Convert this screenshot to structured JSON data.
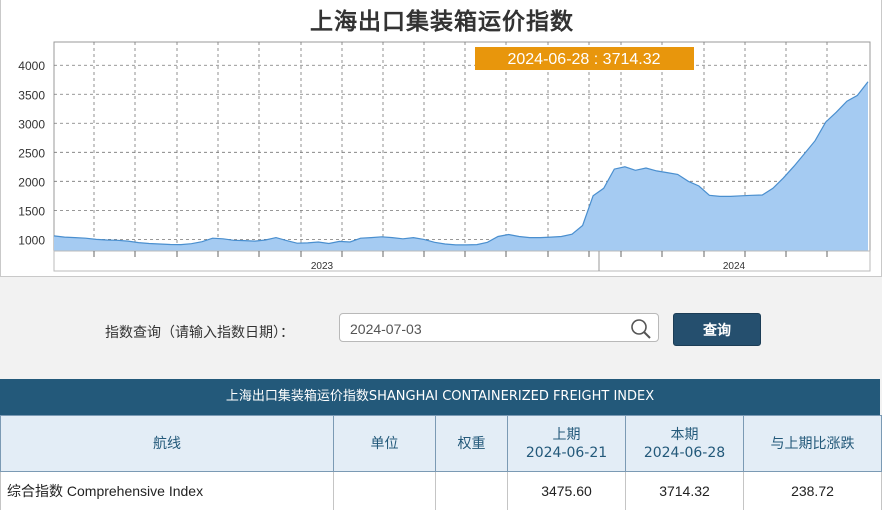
{
  "page": {
    "title": "上海出口集装箱运价指数"
  },
  "chart_data": {
    "type": "area",
    "title": "上海出口集装箱运价指数",
    "xlabel": "",
    "ylabel": "",
    "y_ticks": [
      1000,
      1500,
      2000,
      2500,
      3000,
      3500,
      4000
    ],
    "x_axis_labels": [
      "2023",
      "2024"
    ],
    "grid": true,
    "tooltip": "2024-06-28 : 3714.32",
    "series": [
      {
        "values": [
          1060,
          1040,
          1030,
          1020,
          1000,
          990,
          985,
          970,
          945,
          930,
          920,
          912,
          910,
          925,
          960,
          1020,
          1010,
          985,
          980,
          970,
          990,
          1030,
          980,
          935,
          940,
          955,
          930,
          965,
          955,
          1020,
          1030,
          1045,
          1030,
          1010,
          1030,
          1000,
          950,
          920,
          905,
          905,
          910,
          950,
          1050,
          1085,
          1050,
          1030,
          1030,
          1040,
          1050,
          1090,
          1240,
          1750,
          1880,
          2210,
          2250,
          2190,
          2230,
          2180,
          2150,
          2120,
          2000,
          1920,
          1760,
          1740,
          1740,
          1750,
          1760,
          1765,
          1880,
          2060,
          2260,
          2480,
          2700,
          3020,
          3190,
          3380,
          3480,
          3714.32
        ]
      }
    ],
    "colors": {
      "fill": "#a5cbf2",
      "line": "#4a8fcf"
    }
  },
  "query": {
    "label": "指数查询（请输入指数日期）：",
    "date_value": "2024-07-03",
    "button_label": "查询"
  },
  "table": {
    "title": "上海出口集装箱运价指数SHANGHAI CONTAINERIZED FREIGHT INDEX",
    "headers": {
      "route": "航线",
      "unit": "单位",
      "weight": "权重",
      "prev_label": "上期",
      "prev_date": "2024-06-21",
      "curr_label": "本期",
      "curr_date": "2024-06-28",
      "change": "与上期比涨跌"
    },
    "rows": [
      {
        "route": "综合指数 Comprehensive Index",
        "unit": "",
        "weight": "",
        "prev": "3475.60",
        "curr": "3714.32",
        "change": "238.72"
      }
    ]
  }
}
